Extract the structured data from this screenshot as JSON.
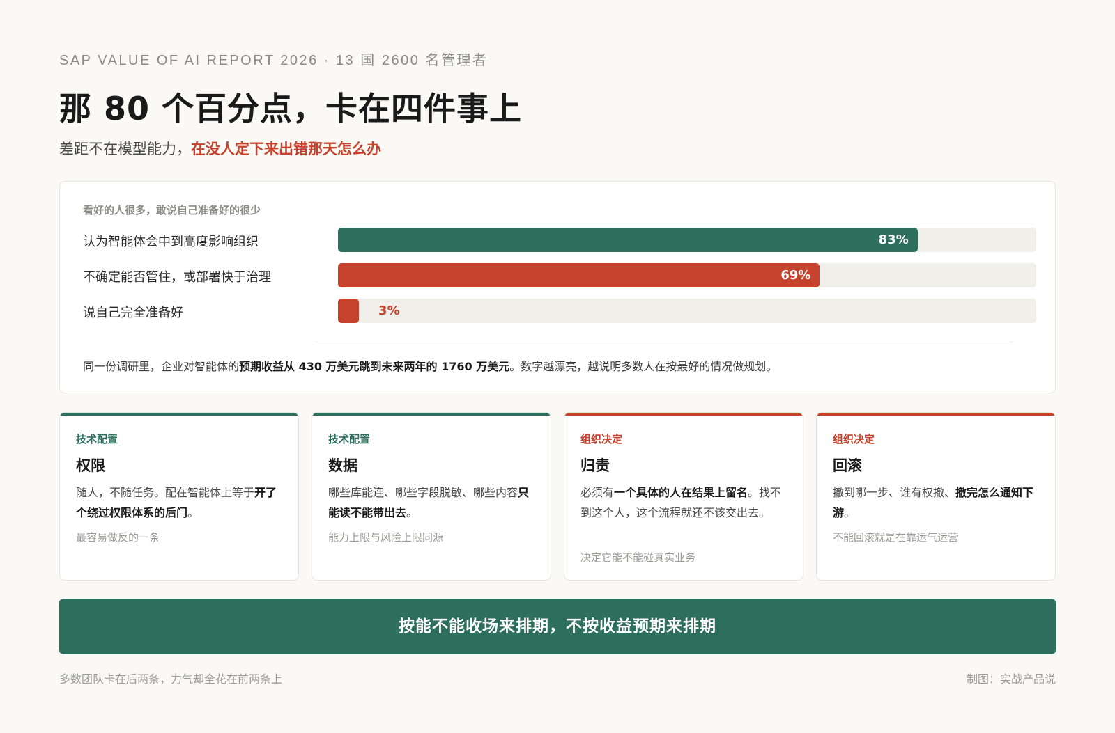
{
  "header": {
    "overline": "SAP VALUE OF AI REPORT 2026 · 13 国 2600 名管理者",
    "title": "那 80 个百分点，卡在四件事上",
    "subtitle_plain": "差距不在模型能力，",
    "subtitle_highlight": "在没人定下来出错那天怎么办"
  },
  "survey_card": {
    "caption": "看好的人很多，敢说自己准备好的很少",
    "bars": [
      {
        "label": "认为智能体会中到高度影响组织",
        "value": 83,
        "value_label": "83%",
        "color": "#2e6e5c"
      },
      {
        "label": "不确定能否管住，或部署快于治理",
        "value": 69,
        "value_label": "69%",
        "color": "#c6422c"
      },
      {
        "label": "说自己完全准备好",
        "value": 3,
        "value_label": "3%",
        "color": "#c6422c"
      }
    ],
    "note": {
      "part1": "同一份调研里，企业对智能体的",
      "bold": "预期收益从 430 万美元跳到未来两年的 1760 万美元",
      "part2": "。数字越漂亮，越说明多数人在按最好的情况做规划。"
    }
  },
  "factors": [
    {
      "category": "技术配置",
      "accent": "#2e6e5c",
      "name": "权限",
      "desc_plain": "随人，不随任务。配在智能体上等于",
      "desc_bold": "开了个绕过权限体系的后门",
      "desc_tail": "。",
      "note": "最容易做反的一条"
    },
    {
      "category": "技术配置",
      "accent": "#2e6e5c",
      "name": "数据",
      "desc_plain": "哪些库能连、哪些字段脱敏、哪些内容",
      "desc_bold": "只能读不能带出去",
      "desc_tail": "。",
      "note": "能力上限与风险上限同源"
    },
    {
      "category": "组织决定",
      "accent": "#c6422c",
      "name": "归责",
      "desc_plain": "必须有",
      "desc_bold": "一个具体的人在结果上留名",
      "desc_tail": "。找不到这个人，这个流程就还不该交出去。",
      "note": "决定它能不能碰真实业务"
    },
    {
      "category": "组织决定",
      "accent": "#c6422c",
      "name": "回滚",
      "desc_plain": "撤到哪一步、谁有权撤、",
      "desc_bold": "撤完怎么通知下游",
      "desc_tail": "。",
      "note": "不能回滚就是在靠运气运营"
    }
  ],
  "cta": "按能不能收场来排期，不按收益预期来排期",
  "footer": {
    "left": "多数团队卡在后两条，力气却全花在前两条上",
    "right": "制图：实战产品说"
  }
}
